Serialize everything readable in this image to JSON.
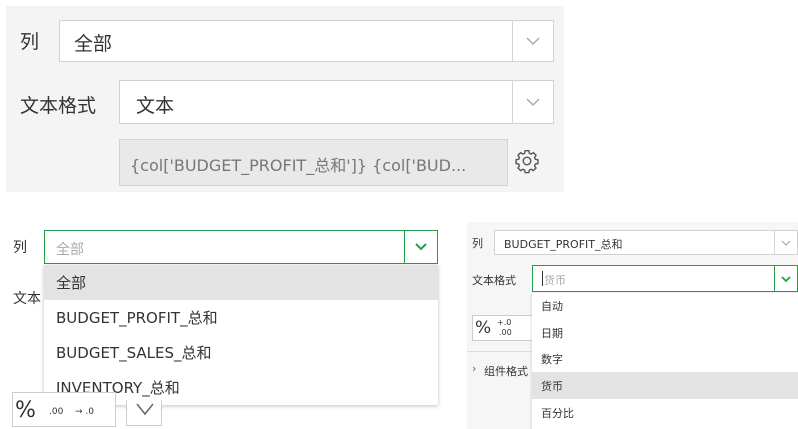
{
  "top_panel": {
    "column_label": "列",
    "column_value": "全部",
    "format_label": "文本格式",
    "format_value": "文本",
    "expression": "{col['BUDGET_PROFIT_总和']} {col['BUD..."
  },
  "bottom_left": {
    "column_label": "列",
    "column_placeholder": "全部",
    "format_label_partial": "文本",
    "options": [
      "全部",
      "BUDGET_PROFIT_总和",
      "BUDGET_SALES_总和",
      "INVENTORY_总和"
    ],
    "selected_option": "全部",
    "toolbar": {
      "percent": "%",
      "dec_down": ".00",
      "dec_up": "→ .0"
    }
  },
  "bottom_right": {
    "column_label": "列",
    "column_value": "BUDGET_PROFIT_总和",
    "format_label": "文本格式",
    "format_value": "货币",
    "options": [
      "自动",
      "日期",
      "数字",
      "货币",
      "百分比"
    ],
    "selected_option": "货币",
    "section_label": "组件格式",
    "toolbar": {
      "percent": "%",
      "dec_up": "+.0",
      "dec_down": ".00"
    }
  },
  "colors": {
    "accent_green": "#21a04a",
    "selected_bg": "#e3e3e3",
    "panel_bg": "#f4f4f4"
  }
}
